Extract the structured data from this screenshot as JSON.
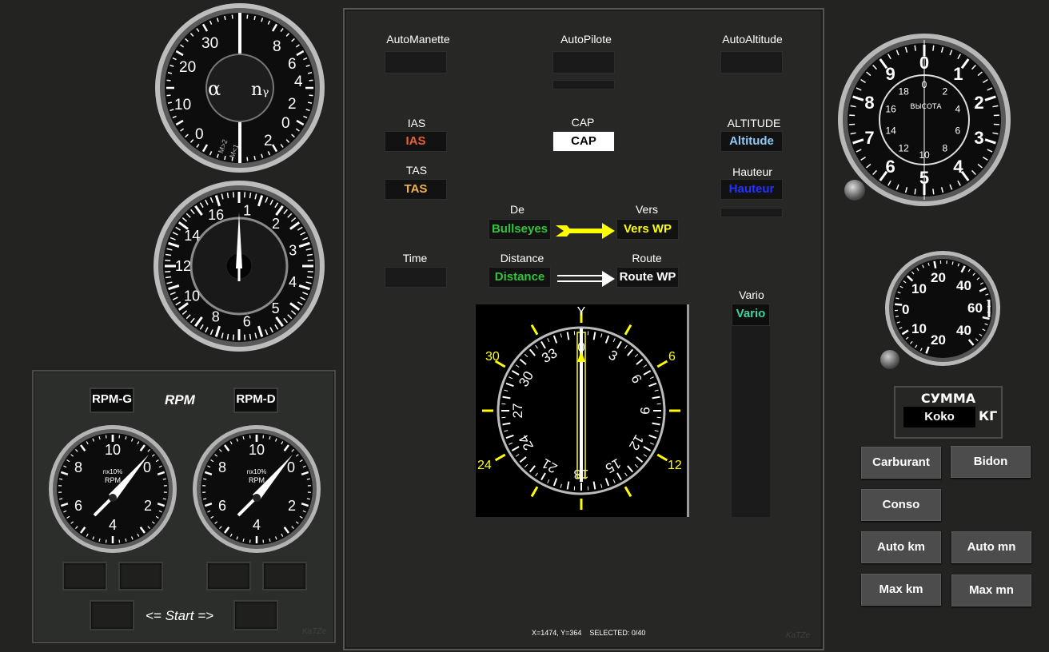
{
  "rpm_panel": {
    "title": "RPM",
    "left_display": "RPM-G",
    "right_display": "RPM-D",
    "start_label": "<= Start =>",
    "gauge_scale": [
      "10",
      "0",
      "2",
      "4",
      "6",
      "8"
    ],
    "gauge_face_line1": "nx10%",
    "gauge_face_line2": "RPM",
    "watermark": "KaTZe"
  },
  "aoa_gauge": {
    "left_scale": [
      "30",
      "20",
      "10",
      "0"
    ],
    "right_scale": [
      "8",
      "6",
      "4",
      "2",
      "0",
      "2"
    ],
    "alpha": "α",
    "ny": "nᵧ",
    "mach1": "M>2",
    "mach2": "M<1"
  },
  "speed_gauge": {
    "scale": [
      "1",
      "2",
      "3",
      "4",
      "5",
      "6",
      "8",
      "10",
      "12",
      "14",
      "16"
    ]
  },
  "main": {
    "automanette": "AutoManette",
    "autopilote": "AutoPilote",
    "autoaltitude": "AutoAltitude",
    "ias_caption": "IAS",
    "ias_value": "IAS",
    "tas_caption": "TAS",
    "tas_value": "TAS",
    "cap_caption": "CAP",
    "cap_value": "CAP",
    "altitude_caption": "ALTITUDE",
    "altitude_value": "Altitude",
    "hauteur_caption": "Hauteur",
    "hauteur_value": "Hauteur",
    "de_caption": "De",
    "de_value": "Bullseyes",
    "vers_caption": "Vers",
    "vers_value": "Vers WP",
    "time_caption": "Time",
    "distance_caption": "Distance",
    "distance_value": "Distance",
    "route_caption": "Route",
    "route_value": "Route WP",
    "vario_caption": "Vario",
    "vario_value": "Vario",
    "status": "X=1474, Y=364    SELECTED: 0/40",
    "watermark": "KaTZe",
    "colors": {
      "ias": "#e8613a",
      "tas": "#f3b24a",
      "altitude": "#8fc9f5",
      "hauteur": "#2233ff",
      "green": "#33c43a",
      "yellow": "#ffff00",
      "vario": "#3fd49e"
    }
  },
  "compass": {
    "outer_labels": [
      "30",
      "6",
      "24",
      "12"
    ],
    "inner_labels": [
      "0",
      "3",
      "6",
      "9",
      "12",
      "15",
      "18",
      "21",
      "24",
      "27",
      "30",
      "33"
    ],
    "top_marker": "Y"
  },
  "altimeter": {
    "outer": [
      "0",
      "1",
      "2",
      "3",
      "4",
      "5",
      "6",
      "7",
      "8",
      "9"
    ],
    "inner": [
      "0",
      "2",
      "4",
      "6",
      "8",
      "10",
      "12",
      "14",
      "16",
      "18"
    ],
    "label": "ВЫСОТА"
  },
  "vario_gauge": {
    "labels": [
      "10",
      "20",
      "40",
      "60",
      "40",
      "20",
      "10",
      "0"
    ]
  },
  "summa": {
    "title": "СУММА",
    "value": "Koko",
    "unit": "КГ"
  },
  "buttons": {
    "carburant": "Carburant",
    "bidon": "Bidon",
    "conso": "Conso",
    "auto_km": "Auto km",
    "auto_mn": "Auto mn",
    "max_km": "Max km",
    "max_mn": "Max mn"
  }
}
